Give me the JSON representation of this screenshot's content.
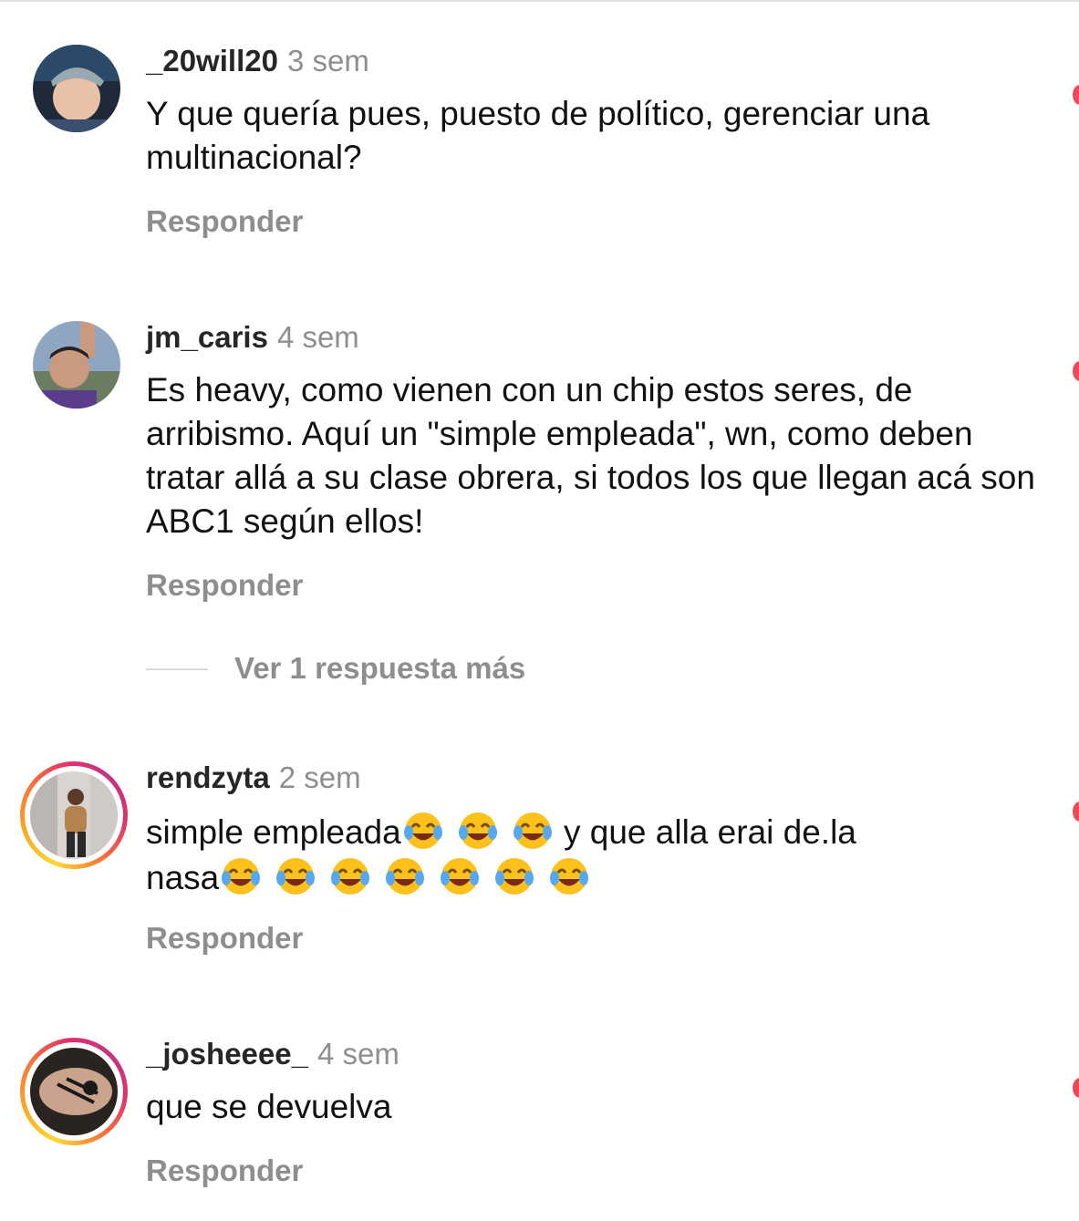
{
  "comments": [
    {
      "username": "_20will20",
      "time": "3 sem",
      "text": "Y que quería pues, puesto de político, gerenciar una multinacional?",
      "reply_label": "Responder",
      "has_story_ring": false
    },
    {
      "username": "jm_caris",
      "time": "4 sem",
      "text": "Es heavy, como vienen con un chip estos seres, de arribismo. Aquí un \"simple empleada\", wn, como deben tratar allá a su clase obrera, si todos los que llegan acá son ABC1 según ellos!",
      "reply_label": "Responder",
      "has_story_ring": false,
      "more_replies": "Ver 1 respuesta más"
    },
    {
      "username": "rendzyta",
      "time": "2 sem",
      "text_part1": "simple empleada",
      "text_part2": " y que alla erai de.la",
      "text_part3": "nasa",
      "emoji_name": "face-with-tears-of-joy-icon",
      "reply_label": "Responder",
      "has_story_ring": true
    },
    {
      "username": "_josheeee_",
      "time": "4 sem",
      "text": "que se devuelva",
      "reply_label": "Responder",
      "has_story_ring": true
    }
  ],
  "colors": {
    "username": "#262626",
    "secondary": "#8e8e8e",
    "like_dot": "#ed4956",
    "story_ring": "#e1306c"
  }
}
